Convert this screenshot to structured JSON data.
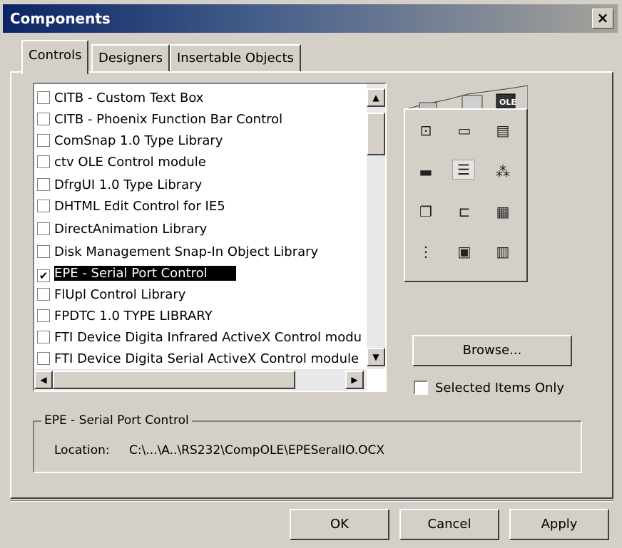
{
  "window": {
    "title": "Components",
    "close_glyph": "×"
  },
  "tabs": [
    {
      "label": "Controls",
      "active": true
    },
    {
      "label": "Designers",
      "active": false
    },
    {
      "label": "Insertable Objects",
      "active": false
    }
  ],
  "list": {
    "items": [
      {
        "label": "CITB - Custom Text Box",
        "checked": false
      },
      {
        "label": "CITB - Phoenix Function Bar Control",
        "checked": false
      },
      {
        "label": "ComSnap 1.0 Type Library",
        "checked": false
      },
      {
        "label": "ctv OLE Control module",
        "checked": false
      },
      {
        "label": "DfrgUI 1.0 Type Library",
        "checked": false
      },
      {
        "label": "DHTML Edit Control for IE5",
        "checked": false
      },
      {
        "label": "DirectAnimation Library",
        "checked": false
      },
      {
        "label": "Disk Management Snap-In Object Library",
        "checked": false
      },
      {
        "label": "EPE - Serial Port Control",
        "checked": true,
        "selected": true
      },
      {
        "label": "FlUpl Control Library",
        "checked": false
      },
      {
        "label": "FPDTC 1.0 TYPE LIBRARY",
        "checked": false
      },
      {
        "label": "FTI Device Digita Infrared ActiveX Control modu",
        "checked": false
      },
      {
        "label": "FTI Device Digita Serial ActiveX Control module",
        "checked": false
      }
    ]
  },
  "toolbox": {
    "ole_label": "OLE",
    "icons": [
      "textbox-icon",
      "label-icon",
      "frame-icon",
      "progressbar-icon",
      "treeview-icon",
      "listview-icon",
      "tabstrip-icon",
      "toolbar-icon",
      "imagelist-icon",
      "grid-icon",
      "form-icon",
      "calendar-icon"
    ]
  },
  "buttons": {
    "browse": "Browse...",
    "ok": "OK",
    "cancel": "Cancel",
    "apply": "Apply"
  },
  "options": {
    "selected_only_label": "Selected Items Only",
    "selected_only_checked": false
  },
  "details": {
    "title": "EPE - Serial Port Control",
    "location_label": "Location:",
    "location_value": "C:\\...\\A..\\RS232\\CompOLE\\EPESeralIO.OCX"
  }
}
